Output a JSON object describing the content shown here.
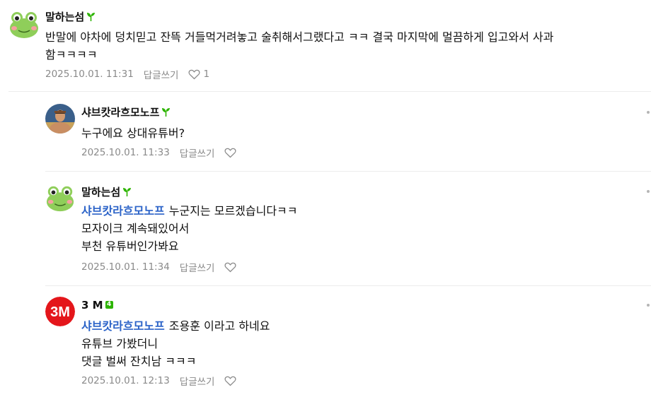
{
  "comments": [
    {
      "nickname": "말하는섬",
      "avatar_icon": "frog-icon",
      "lines": [
        "반말에 야차에 덩치믿고 잔뜩 거들먹거려놓고 술취해서그랬다고 ㅋㅋ 결국 마지막에 멀끔하게 입고와서 사과",
        "함ㅋㅋㅋㅋ"
      ],
      "date": "2025.10.01. 11:31",
      "reply_label": "답글쓰기",
      "like_count": "1"
    },
    {
      "nickname": "샤브캇라흐모노프",
      "avatar_icon": "fighter-photo",
      "lines": [
        "누구에요 상대유튜버?"
      ],
      "date": "2025.10.01. 11:33",
      "reply_label": "답글쓰기"
    },
    {
      "nickname": "말하는섬",
      "avatar_icon": "frog-icon",
      "mention": "샤브캇라흐모노프",
      "lines": [
        "누군지는 모르겠습니다ㅋㅋ",
        "모자이크 계속돼있어서",
        "부천 유튜버인가봐요"
      ],
      "date": "2025.10.01. 11:34",
      "reply_label": "답글쓰기"
    },
    {
      "nickname": "3 M",
      "avatar_icon": "3m-logo",
      "avatar_logo_text": "3M",
      "level_badge": "4",
      "mention": "샤브캇라흐모노프",
      "lines": [
        "조용훈 이라고 하네요",
        "유튜브 가봤더니",
        "댓글 벌써 잔치남 ㅋㅋㅋ"
      ],
      "date": "2025.10.01. 12:13",
      "reply_label": "답글쓰기"
    }
  ],
  "colors": {
    "mention": "#2b63c8",
    "meta": "#8a8a8a",
    "sprout": "#2db400",
    "logo_red": "#e4161b"
  }
}
